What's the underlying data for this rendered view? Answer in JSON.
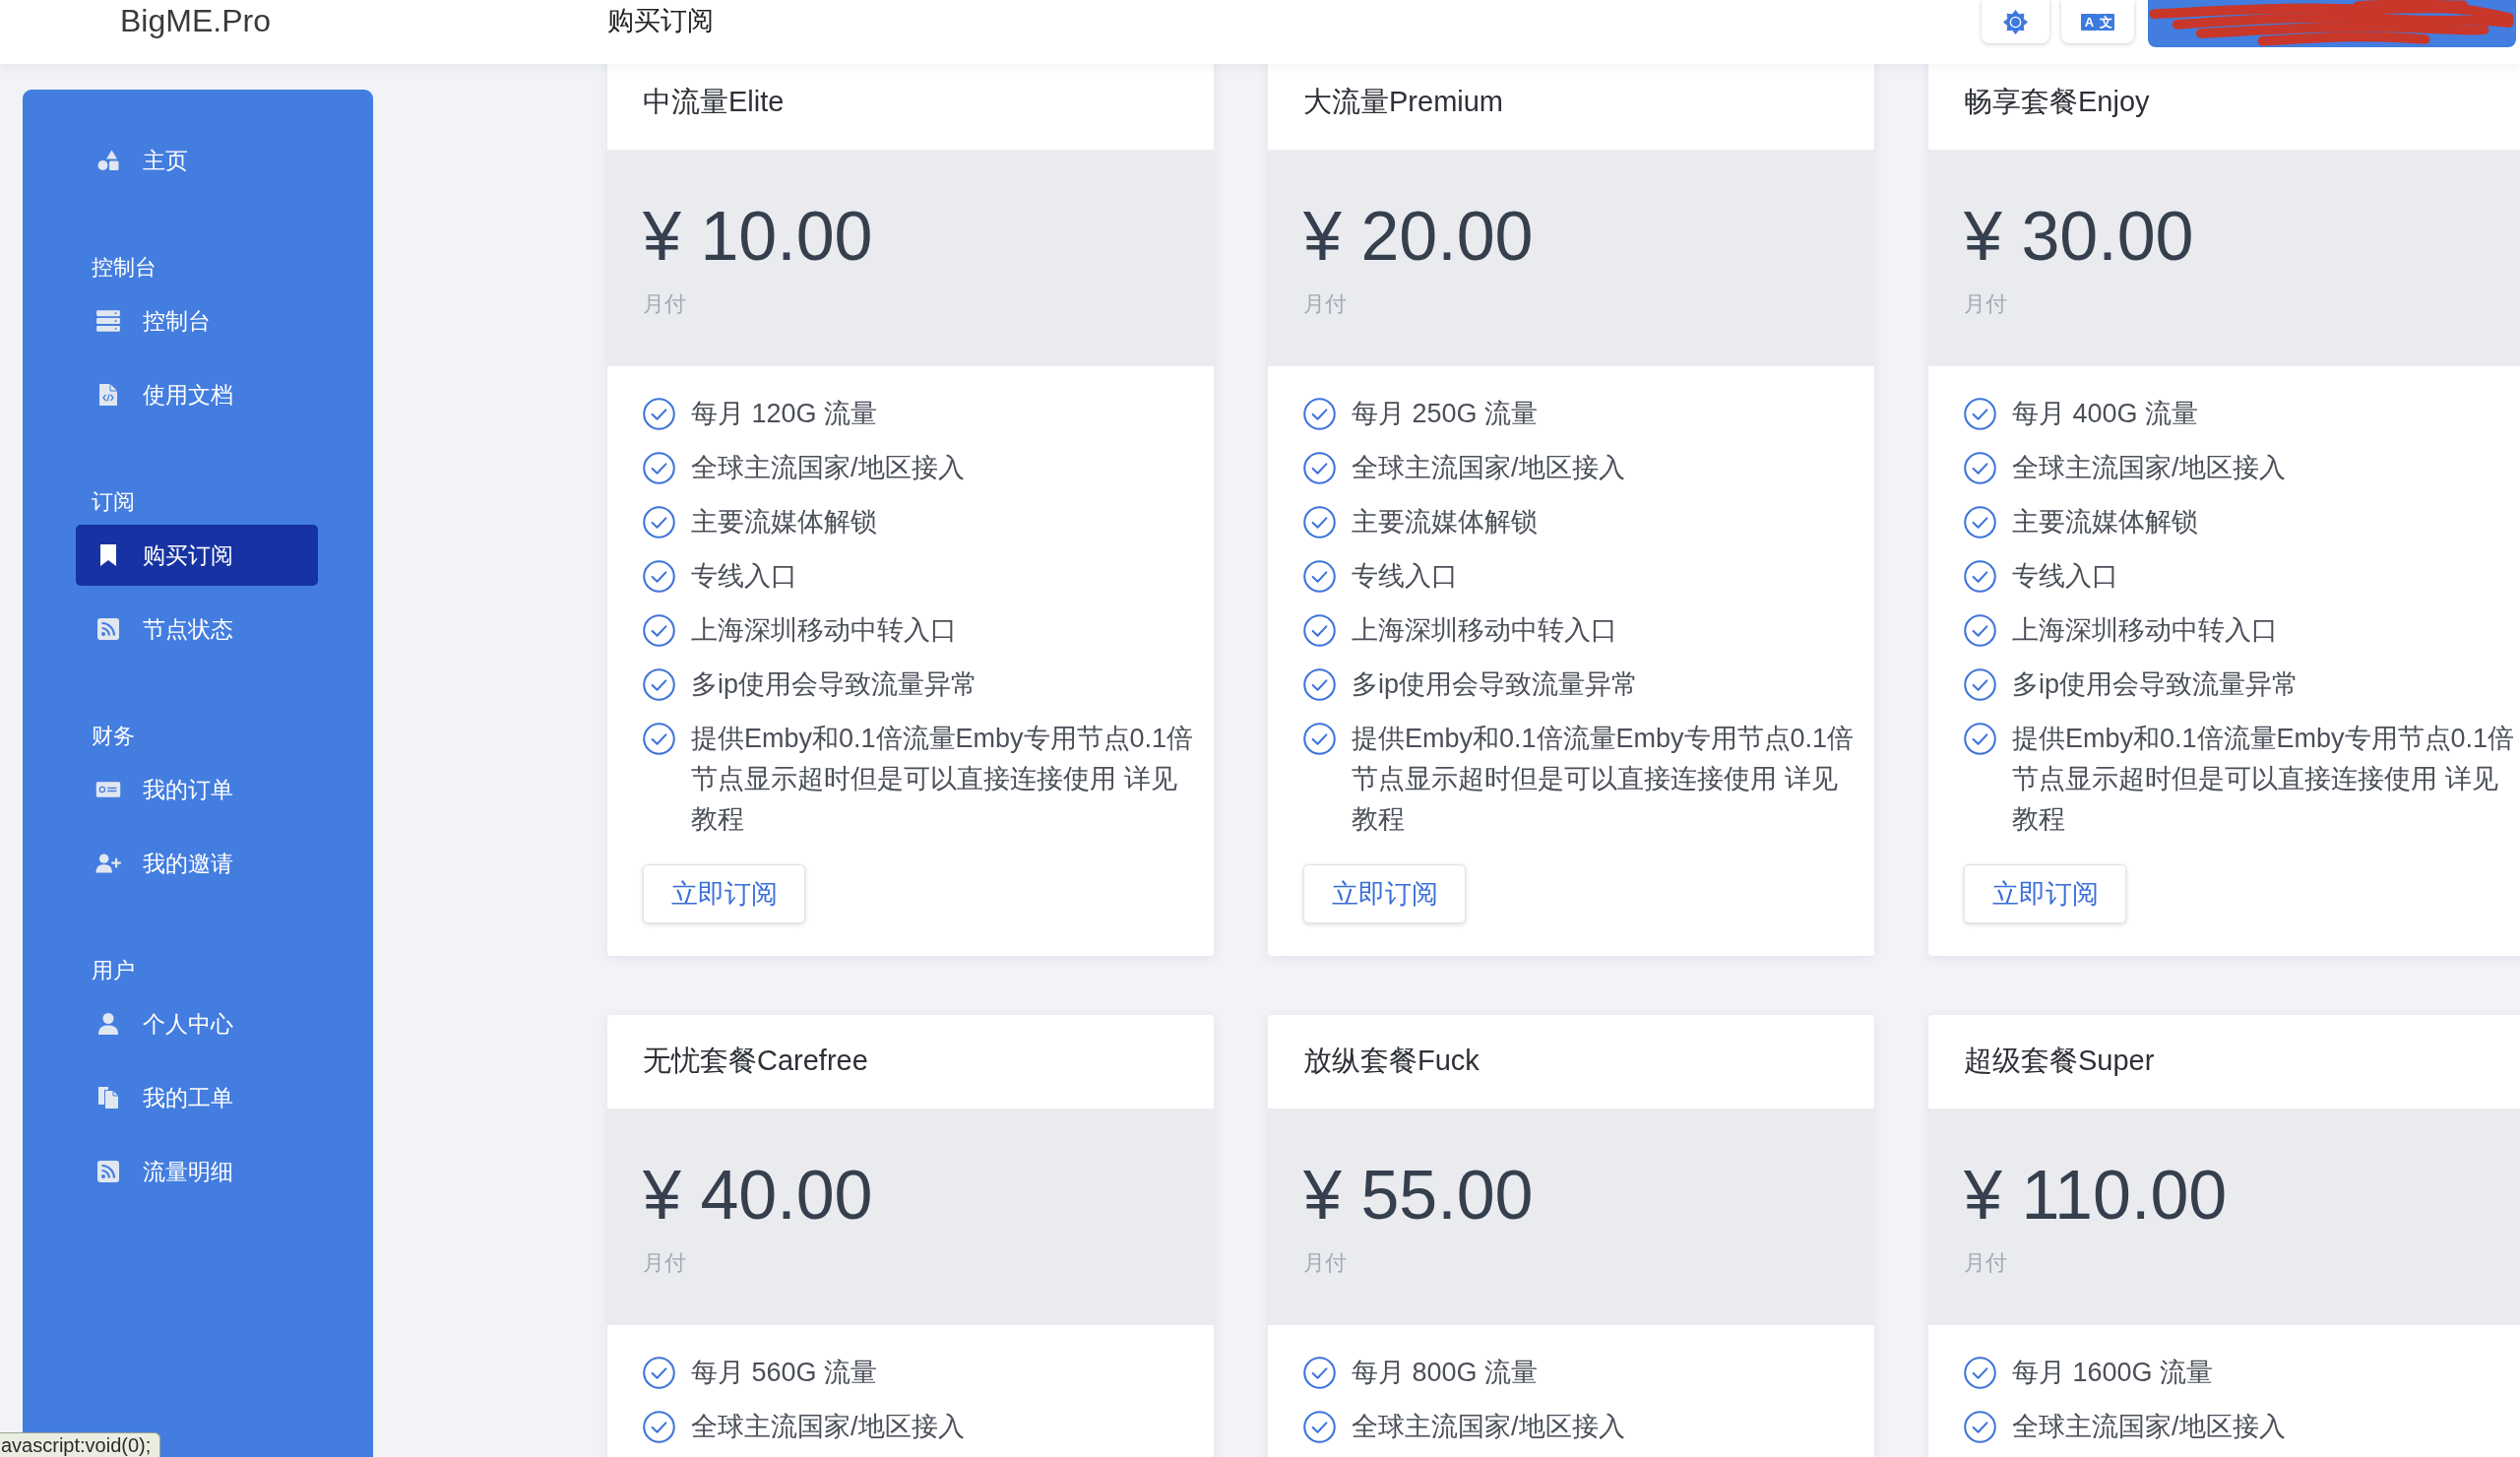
{
  "header": {
    "logo": "BigME.Pro",
    "title": "购买订阅",
    "translate_glyphs": [
      "A",
      "文"
    ]
  },
  "sidebar": {
    "sections": [
      {
        "items": [
          {
            "label": "主页",
            "selected": false
          }
        ]
      },
      {
        "heading": "控制台",
        "items": [
          {
            "label": "控制台",
            "selected": false
          },
          {
            "label": "使用文档",
            "selected": false
          }
        ]
      },
      {
        "heading": "订阅",
        "items": [
          {
            "label": "购买订阅",
            "selected": true
          },
          {
            "label": "节点状态",
            "selected": false
          }
        ]
      },
      {
        "heading": "财务",
        "items": [
          {
            "label": "我的订单",
            "selected": false
          },
          {
            "label": "我的邀请",
            "selected": false
          }
        ]
      },
      {
        "heading": "用户",
        "items": [
          {
            "label": "个人中心",
            "selected": false
          },
          {
            "label": "我的工单",
            "selected": false
          },
          {
            "label": "流量明细",
            "selected": false
          }
        ]
      }
    ]
  },
  "plans": [
    {
      "name": "中流量Elite",
      "price": "¥ 10.00",
      "period": "月付",
      "features": [
        "每月 120G 流量",
        "全球主流国家/地区接入",
        "主要流媒体解锁",
        "专线入口",
        "上海深圳移动中转入口",
        "多ip使用会导致流量异常",
        "提供Emby和0.1倍流量Emby专用节点0.1倍节点显示超时但是可以直接连接使用 详见教程"
      ],
      "button": "立即订阅"
    },
    {
      "name": "大流量Premium",
      "price": "¥ 20.00",
      "period": "月付",
      "features": [
        "每月 250G 流量",
        "全球主流国家/地区接入",
        "主要流媒体解锁",
        "专线入口",
        "上海深圳移动中转入口",
        "多ip使用会导致流量异常",
        "提供Emby和0.1倍流量Emby专用节点0.1倍节点显示超时但是可以直接连接使用 详见教程"
      ],
      "button": "立即订阅"
    },
    {
      "name": "畅享套餐Enjoy",
      "price": "¥ 30.00",
      "period": "月付",
      "features": [
        "每月 400G 流量",
        "全球主流国家/地区接入",
        "主要流媒体解锁",
        "专线入口",
        "上海深圳移动中转入口",
        "多ip使用会导致流量异常",
        "提供Emby和0.1倍流量Emby专用节点0.1倍节点显示超时但是可以直接连接使用 详见教程"
      ],
      "button": "立即订阅"
    },
    {
      "name": "无忧套餐Carefree",
      "price": "¥ 40.00",
      "period": "月付",
      "features": [
        "每月 560G 流量",
        "全球主流国家/地区接入"
      ]
    },
    {
      "name": "放纵套餐Fuck",
      "price": "¥ 55.00",
      "period": "月付",
      "features": [
        "每月 800G 流量",
        "全球主流国家/地区接入"
      ]
    },
    {
      "name": "超级套餐Super",
      "price": "¥ 110.00",
      "period": "月付",
      "features": [
        "每月 1600G 流量",
        "全球主流国家/地区接入"
      ]
    }
  ],
  "status_url": "avascript:void(0);"
}
